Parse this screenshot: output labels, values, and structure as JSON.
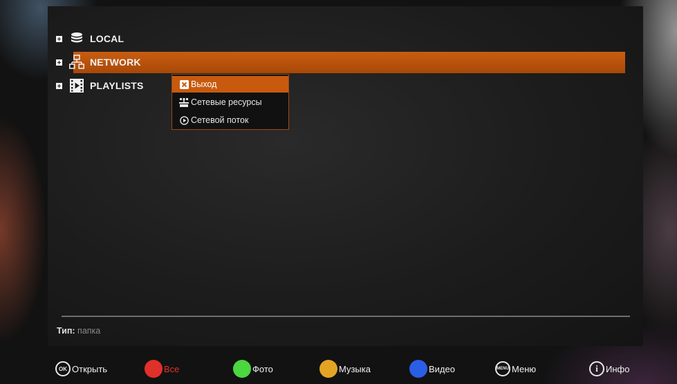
{
  "tree": {
    "items": [
      {
        "label": "LOCAL",
        "icon": "database-icon"
      },
      {
        "label": "NETWORK",
        "icon": "network-icon",
        "selected": true
      },
      {
        "label": "PLAYLISTS",
        "icon": "filmstrip-icon"
      }
    ]
  },
  "context_menu": {
    "items": [
      {
        "label": "Выход",
        "icon": "close-icon",
        "active": true
      },
      {
        "label": "Сетевые ресурсы",
        "icon": "network-resources-icon"
      },
      {
        "label": "Сетевой поток",
        "icon": "play-circle-icon"
      }
    ]
  },
  "status": {
    "type_label": "Тип:",
    "type_value": "папка"
  },
  "hints": {
    "ok_icon_text": "OK",
    "open": "Открыть",
    "all": "Все",
    "photo": "Фото",
    "music": "Музыка",
    "video": "Видео",
    "menu_icon_text": "MENU",
    "menu": "Меню",
    "info_icon_text": "i",
    "info": "Инфо"
  },
  "colors": {
    "accent": "#c95d10",
    "red": "#e0302a",
    "green": "#4cd640",
    "yellow": "#e4a423",
    "blue": "#2a5ee6"
  }
}
